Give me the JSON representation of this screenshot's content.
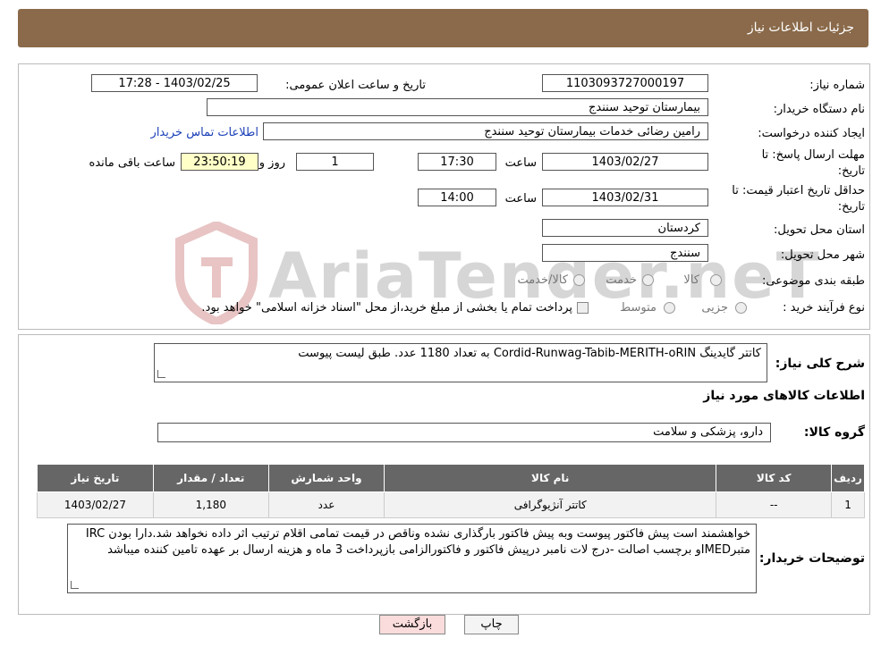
{
  "header": {
    "title": "جزئیات اطلاعات نیاز"
  },
  "form": {
    "need_number_label": "شماره نیاز:",
    "need_number": "1103093727000197",
    "announce_label": "تاریخ و ساعت اعلان عمومی:",
    "announce_value": "1403/02/25 - 17:28",
    "buyer_org_label": "نام دستگاه خریدار:",
    "buyer_org": "بیمارستان توحید سنندج",
    "creator_label": "ایجاد کننده درخواست:",
    "creator": "رامین رضائی خدمات بیمارستان توحید سنندج",
    "contact_link": "اطلاعات تماس خریدار",
    "reply_deadline_label_1": "مهلت ارسال پاسخ: تا",
    "reply_deadline_label_2": "تاریخ:",
    "reply_date": "1403/02/27",
    "time_label": "ساعت",
    "reply_time": "17:30",
    "days_value": "1",
    "days_label": "روز و",
    "remaining_time": "23:50:19",
    "remaining_label": "ساعت باقی مانده",
    "price_validity_label_1": "حداقل تاریخ اعتبار قیمت: تا",
    "price_validity_label_2": "تاریخ:",
    "price_validity_date": "1403/02/31",
    "price_validity_time": "14:00",
    "province_label": "استان محل تحویل:",
    "province": "کردستان",
    "city_label": "شهر محل تحویل:",
    "city": "سنندج",
    "category_label": "طبقه بندی موضوعی:",
    "category_options": [
      "کالا",
      "خدمت",
      "کالا/خدمت"
    ],
    "process_label": "نوع فرآیند خرید :",
    "process_options": [
      "جزیی",
      "متوسط"
    ],
    "payment_note": "پرداخت تمام یا بخشی از مبلغ خرید،از محل \"اسناد خزانه اسلامی\" خواهد بود."
  },
  "summary": {
    "description_label": "شرح کلی نیاز:",
    "description": "کاتتر گایدینگ  Cordid-Runwag-Tabib-MERITH-oRIN به تعداد 1180 عدد. طبق لیست پیوست",
    "goods_info_title": "اطلاعات کالاهای مورد نیاز",
    "goods_group_label": "گروه کالا:",
    "goods_group": "دارو، پزشکی و سلامت"
  },
  "table": {
    "headers": [
      "ردیف",
      "کد کالا",
      "نام کالا",
      "واحد شمارش",
      "تعداد / مقدار",
      "تاریخ نیاز"
    ],
    "rows": [
      [
        "1",
        "--",
        "کاتتر آنژیوگرافی",
        "عدد",
        "1,180",
        "1403/02/27"
      ]
    ]
  },
  "buyer_notes": {
    "label": "توضیحات خریدار:",
    "text": "خواهشمند است پیش فاکتور پیوست وبه پیش فاکتور بارگذاری نشده وناقص در قیمت تمامی اقلام ترتیب اثر داده نخواهد شد.دارا بودن IRC متبرIMEDو برچسب اصالت -درج لات نامبر درپیش فاکتور و فاکتورالزامی  بازپرداخت 3 ماه و هزینه ارسال بر عهده تامین کننده میباشد"
  },
  "buttons": {
    "print": "چاپ",
    "back": "بازگشت"
  },
  "watermark": {
    "text": "AriaTender.neT"
  }
}
